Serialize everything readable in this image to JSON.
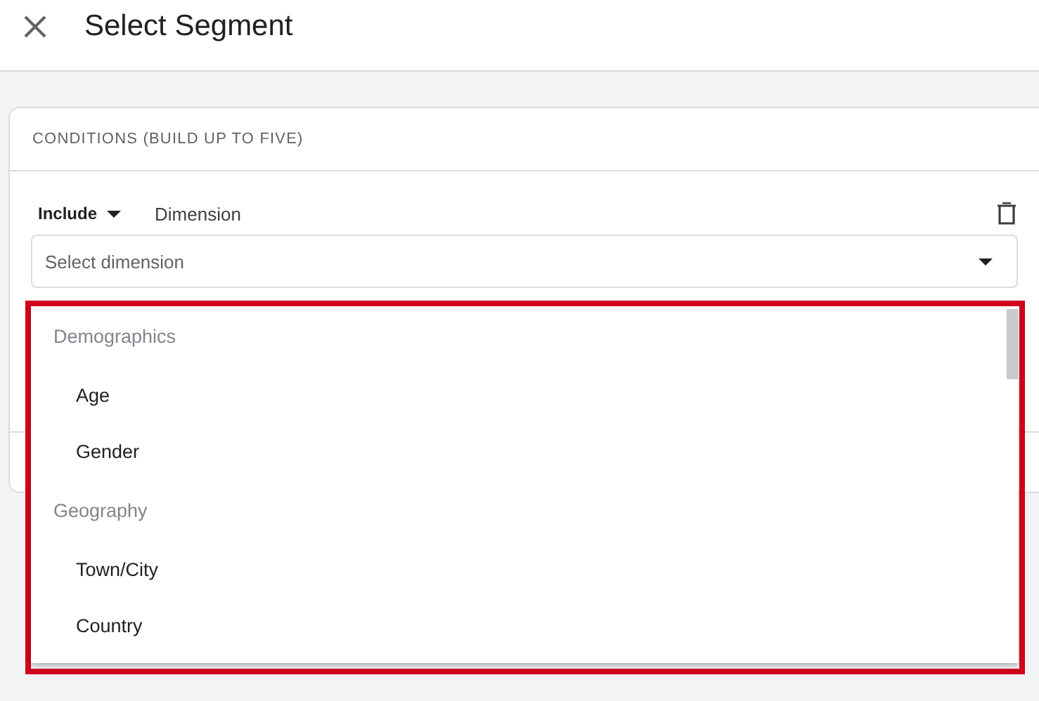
{
  "window": {
    "title": "Select Segment"
  },
  "conditions": {
    "heading": "CONDITIONS (BUILD UP TO FIVE)",
    "rows": [
      {
        "mode": "Include",
        "label": "Dimension",
        "field": {
          "placeholder": "Select dimension"
        }
      }
    ]
  },
  "dropdown": {
    "groups": [
      {
        "label": "Demographics",
        "items": [
          "Age",
          "Gender"
        ]
      },
      {
        "label": "Geography",
        "items": [
          "Town/City",
          "Country"
        ]
      }
    ]
  }
}
